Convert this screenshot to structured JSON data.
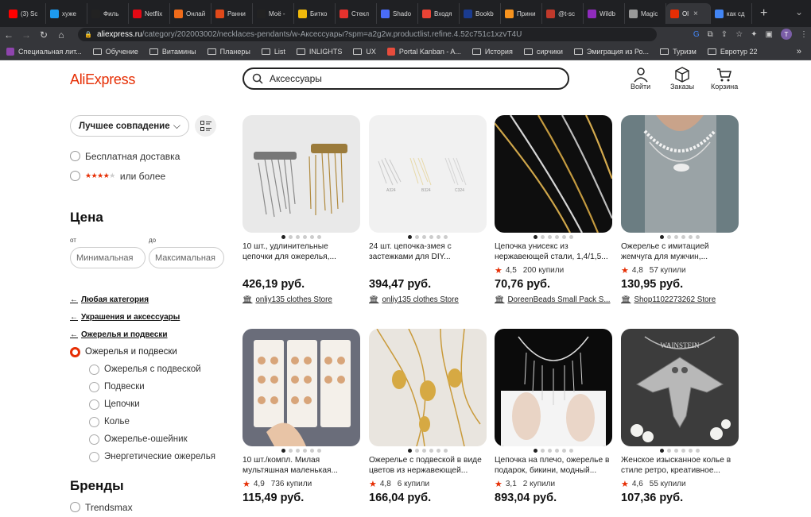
{
  "browser": {
    "tabs": [
      {
        "label": "(3) Sc",
        "icon": "youtube-icon",
        "color": "#ff0000"
      },
      {
        "label": "хуже",
        "icon": "twitter-icon",
        "color": "#1d9bf0"
      },
      {
        "label": "Филь",
        "icon": "kinopoisk-icon",
        "color": "#222"
      },
      {
        "label": "Netflix",
        "icon": "netflix-icon",
        "color": "#e50914"
      },
      {
        "label": "Онлай",
        "icon": "online-icon",
        "color": "#f06b1a"
      },
      {
        "label": "Ранни",
        "icon": "rocket-icon",
        "color": "#e0491a"
      },
      {
        "label": "Моё -",
        "icon": "kinopoisk-icon",
        "color": "#222"
      },
      {
        "label": "Битко",
        "icon": "binance-icon",
        "color": "#f0b90b"
      },
      {
        "label": "Стекл",
        "icon": "s-icon",
        "color": "#e5322d"
      },
      {
        "label": "Shado",
        "icon": "shadow-icon",
        "color": "#4a6cf7"
      },
      {
        "label": "Входя",
        "icon": "gmail-icon",
        "color": "#ea4335"
      },
      {
        "label": "Bookb",
        "icon": "booking-icon",
        "color": "#1a3b8f"
      },
      {
        "label": "Прини",
        "icon": "ok-icon",
        "color": "#f7931e"
      },
      {
        "label": "@t-sc",
        "icon": "calendar-icon",
        "color": "#c0392b"
      },
      {
        "label": "Wildb",
        "icon": "wildberries-icon",
        "color": "#8f2bbd"
      },
      {
        "label": "Magic",
        "icon": "apple-icon",
        "color": "#999"
      },
      {
        "label": "Ol",
        "icon": "aliexpress-icon",
        "color": "#e62e04",
        "active": true
      },
      {
        "label": "как сд",
        "icon": "google-icon",
        "color": "#4285f4"
      }
    ],
    "url_host": "aliexpress.ru",
    "url_path": "/category/202003002/necklaces-pendants/w-Аксессуары?spm=a2g2w.productlist.refine.4.52c751c1xzvT4U",
    "profile_initial": "T",
    "bookmarks": [
      {
        "label": "Специальная лит...",
        "icon": "purple-icon"
      },
      {
        "label": "Обучение",
        "icon": "folder-icon"
      },
      {
        "label": "Витамины",
        "icon": "folder-icon"
      },
      {
        "label": "Планеры",
        "icon": "folder-icon"
      },
      {
        "label": "List",
        "icon": "folder-icon"
      },
      {
        "label": "INLIGHTS",
        "icon": "folder-icon"
      },
      {
        "label": "UX",
        "icon": "folder-icon"
      },
      {
        "label": "Portal Kanban - A...",
        "icon": "kanban-icon"
      },
      {
        "label": "История",
        "icon": "folder-icon"
      },
      {
        "label": "сирчики",
        "icon": "folder-icon"
      },
      {
        "label": "Эмиграция из Ро...",
        "icon": "folder-icon"
      },
      {
        "label": "Туризм",
        "icon": "folder-icon"
      },
      {
        "label": "Евротур 22",
        "icon": "folder-icon"
      }
    ],
    "bookmarks_more": "»"
  },
  "header": {
    "logo": "AliExpress",
    "search_value": "Аксессуары",
    "login_label": "Войти",
    "orders_label": "Заказы",
    "cart_label": "Корзина"
  },
  "sidebar": {
    "sort_label": "Лучшее совпадение",
    "free_shipping": "Бесплатная доставка",
    "rating_filter": "или более",
    "price_heading": "Цена",
    "from_label": "от",
    "to_label": "до",
    "min_placeholder": "Минимальная",
    "max_placeholder": "Максимальная",
    "any_category": "Любая категория",
    "cat_parent": "Украшения и аксессуары",
    "cat_current": "Ожерелья и подвески",
    "cat_selected": "Ожерелья и подвески",
    "subcategories": [
      "Ожерелья с подвеской",
      "Подвески",
      "Цепочки",
      "Колье",
      "Ожерелье-ошейник",
      "Энергетические ожерелья"
    ],
    "brands_heading": "Бренды",
    "brand_first": "Trendsmax"
  },
  "products": [
    {
      "title1": "10 шт., удлинительные",
      "title2": "цепочки для ожерелья,...",
      "rating": "",
      "sold": "",
      "price": "426,19 руб.",
      "store": "onliy135 clothes Store"
    },
    {
      "title1": "24 шт. цепочка-змея с",
      "title2": "застежками для DIY...",
      "rating": "",
      "sold": "",
      "price": "394,47 руб.",
      "store": "onliy135 clothes Store"
    },
    {
      "title1": "Цепочка унисекс из",
      "title2": "нержавеющей стали, 1,4/1,5...",
      "rating": "4,5",
      "sold": "200 купили",
      "price": "70,76 руб.",
      "store": "DoreenBeads Small Pack S..."
    },
    {
      "title1": "Ожерелье с имитацией",
      "title2": "жемчуга для мужчин,...",
      "rating": "4,8",
      "sold": "57 купили",
      "price": "130,95 руб.",
      "store": "Shop1102273262 Store"
    },
    {
      "title1": "10 шт./компл. Милая",
      "title2": "мультяшная маленькая...",
      "rating": "4,9",
      "sold": "736 купили",
      "price": "115,49 руб.",
      "store": ""
    },
    {
      "title1": "Ожерелье с подвеской в виде",
      "title2": "цветов из нержавеющей...",
      "rating": "4,8",
      "sold": "6 купили",
      "price": "166,04 руб.",
      "store": ""
    },
    {
      "title1": "Цепочка на плечо, ожерелье в",
      "title2": "подарок, бикини, модный...",
      "rating": "3,1",
      "sold": "2 купили",
      "price": "893,04 руб.",
      "store": ""
    },
    {
      "title1": "Женское изысканное колье в",
      "title2": "стиле ретро, креативное...",
      "rating": "4,6",
      "sold": "55 купили",
      "price": "107,36 руб.",
      "store": ""
    }
  ],
  "image_text": {
    "p2_labels": [
      "A324",
      "B324",
      "C324"
    ],
    "p8_top": "WAINSTEIN"
  }
}
